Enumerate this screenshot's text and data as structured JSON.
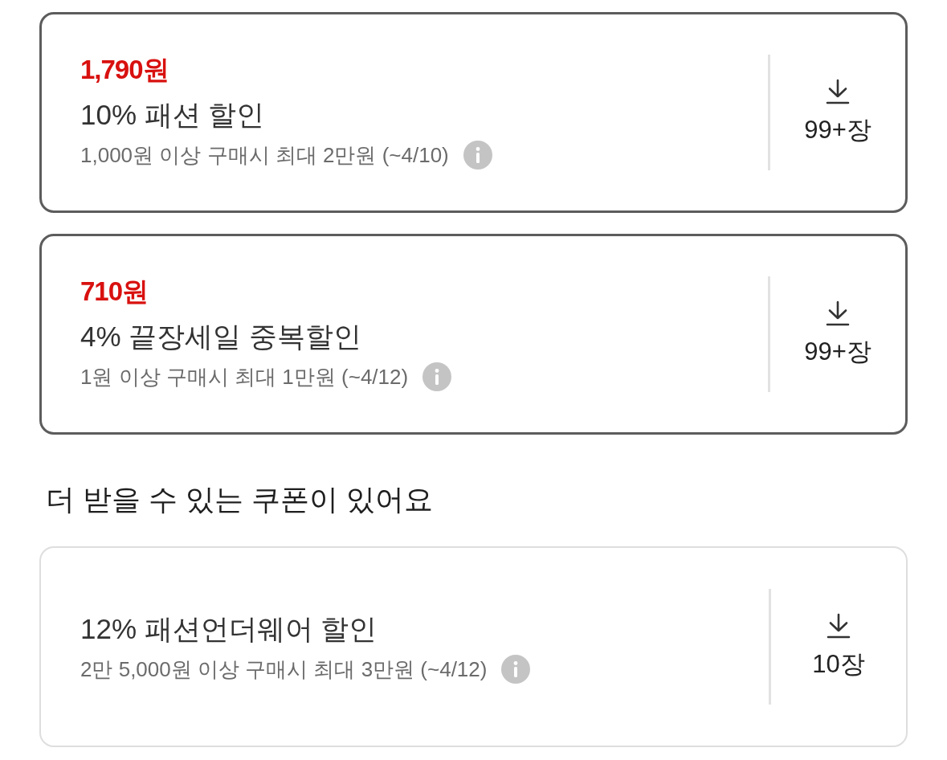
{
  "coupons": [
    {
      "amount": "1,790원",
      "title": "10% 패션 할인",
      "condition": "1,000원 이상 구매시 최대 2만원 (~4/10)",
      "count": "99+장",
      "selected": true
    },
    {
      "amount": "710원",
      "title": "4% 끝장세일 중복할인",
      "condition": "1원 이상 구매시 최대 1만원 (~4/12)",
      "count": "99+장",
      "selected": true
    }
  ],
  "more_coupons": {
    "heading": "더 받을 수 있는 쿠폰이 있어요",
    "items": [
      {
        "title": "12% 패션언더웨어 할인",
        "condition": "2만 5,000원 이상 구매시 최대 3만원 (~4/12)",
        "count": "10장",
        "selected": false
      }
    ]
  }
}
